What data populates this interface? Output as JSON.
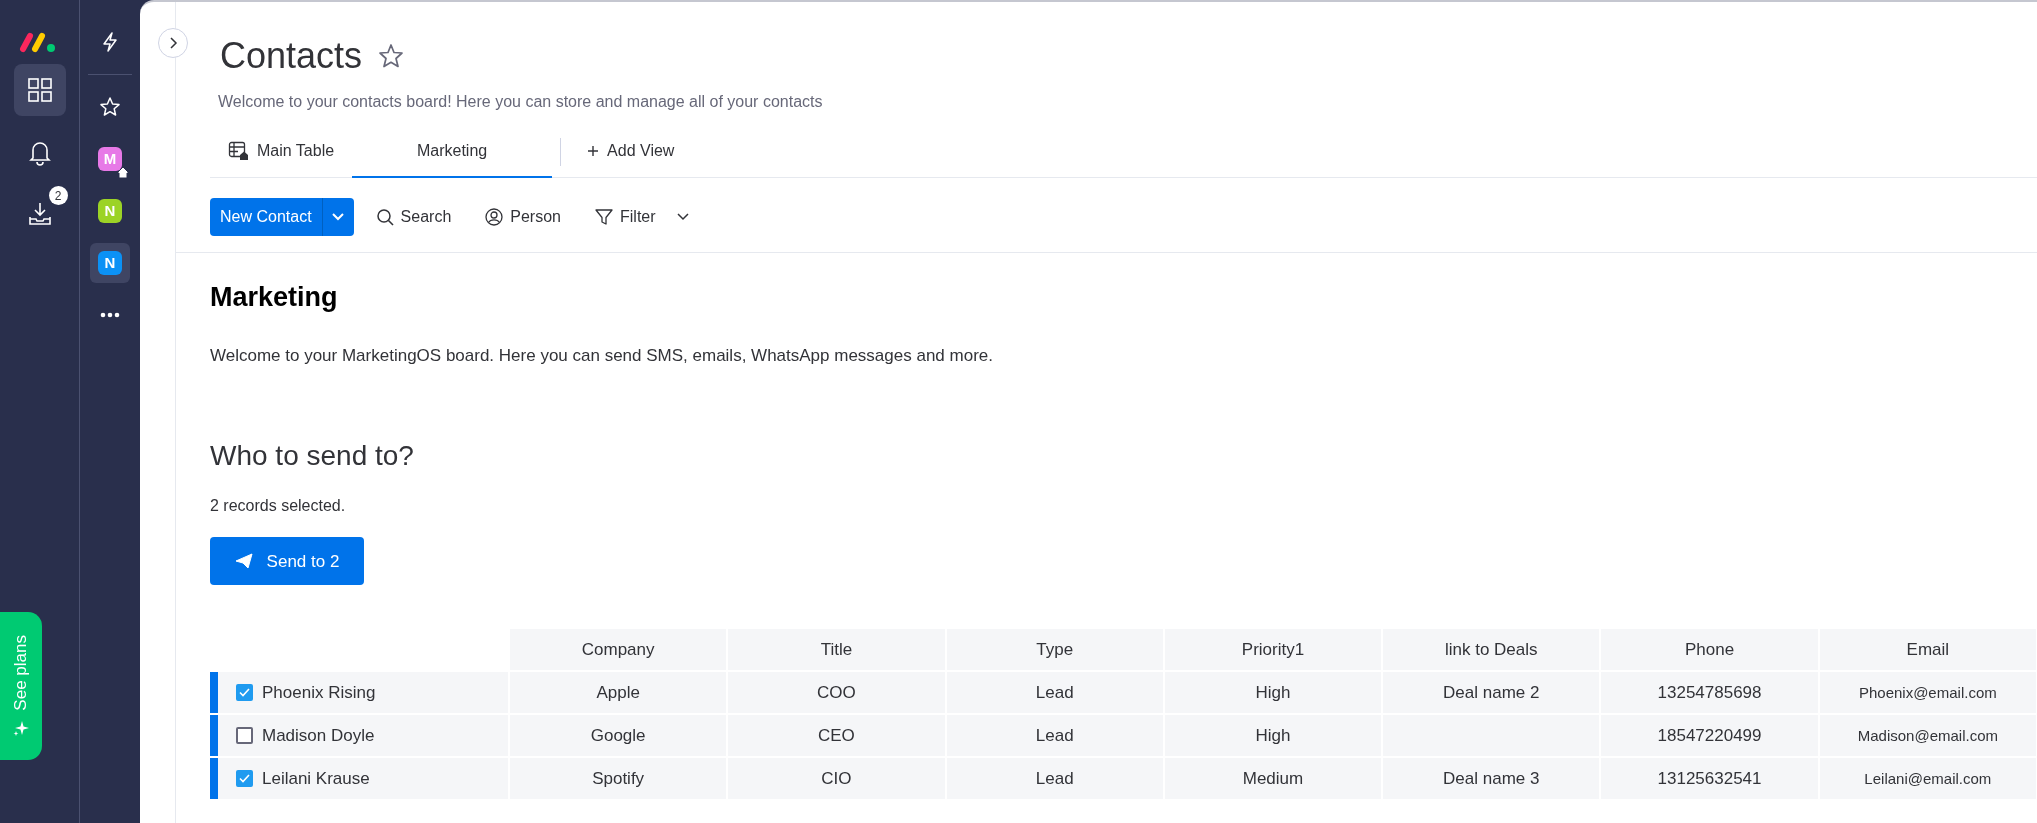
{
  "rail": {
    "items": [
      {
        "kind": "workspace",
        "selected": true
      },
      {
        "kind": "bell",
        "selected": false
      },
      {
        "kind": "inbox",
        "selected": false,
        "badge": "2"
      }
    ],
    "see_plans": "See plans"
  },
  "boards_rail": {
    "boards": [
      {
        "letter": "M",
        "color": "#e779e7",
        "home": true,
        "selected": false
      },
      {
        "letter": "N",
        "color": "#9cd326",
        "home": false,
        "selected": false
      },
      {
        "letter": "N",
        "color": "#0b91f5",
        "home": false,
        "selected": true
      }
    ]
  },
  "board": {
    "title": "Contacts",
    "description": "Welcome to your contacts board! Here you can store and manage all of your contacts",
    "views": [
      {
        "label": "Main Table",
        "kind": "table",
        "selected": false
      },
      {
        "label": "Marketing",
        "kind": "plain",
        "selected": true
      },
      {
        "label": "Add View",
        "kind": "add",
        "selected": false
      }
    ],
    "toolbar": {
      "new_button": "New Contact",
      "tools": [
        {
          "label": "Search",
          "kind": "search"
        },
        {
          "label": "Person",
          "kind": "person"
        },
        {
          "label": "Filter",
          "kind": "filter"
        }
      ]
    }
  },
  "marketing": {
    "heading": "Marketing",
    "intro": "Welcome to your MarketingOS board. Here you can send SMS, emails, WhatsApp messages and more.",
    "question": "Who to send to?",
    "selected_count": "2 records selected.",
    "send_button": "Send to 2"
  },
  "table": {
    "columns": [
      "Company",
      "Title",
      "Type",
      "Priority1",
      "link to Deals",
      "Phone",
      "Email"
    ],
    "rows": [
      {
        "name": "Phoenix Rising",
        "checked": true,
        "cells": [
          "Apple",
          "COO",
          "Lead",
          "High",
          "Deal name 2",
          "13254785698",
          "Phoenix@email.com"
        ]
      },
      {
        "name": "Madison Doyle",
        "checked": false,
        "cells": [
          "Google",
          "CEO",
          "Lead",
          "High",
          "",
          "18547220499",
          "Madison@email.com"
        ]
      },
      {
        "name": "Leilani Krause",
        "checked": true,
        "cells": [
          "Spotify",
          "CIO",
          "Lead",
          "Medium",
          "Deal name 3",
          "13125632541",
          "Leilani@email.com"
        ]
      }
    ]
  }
}
